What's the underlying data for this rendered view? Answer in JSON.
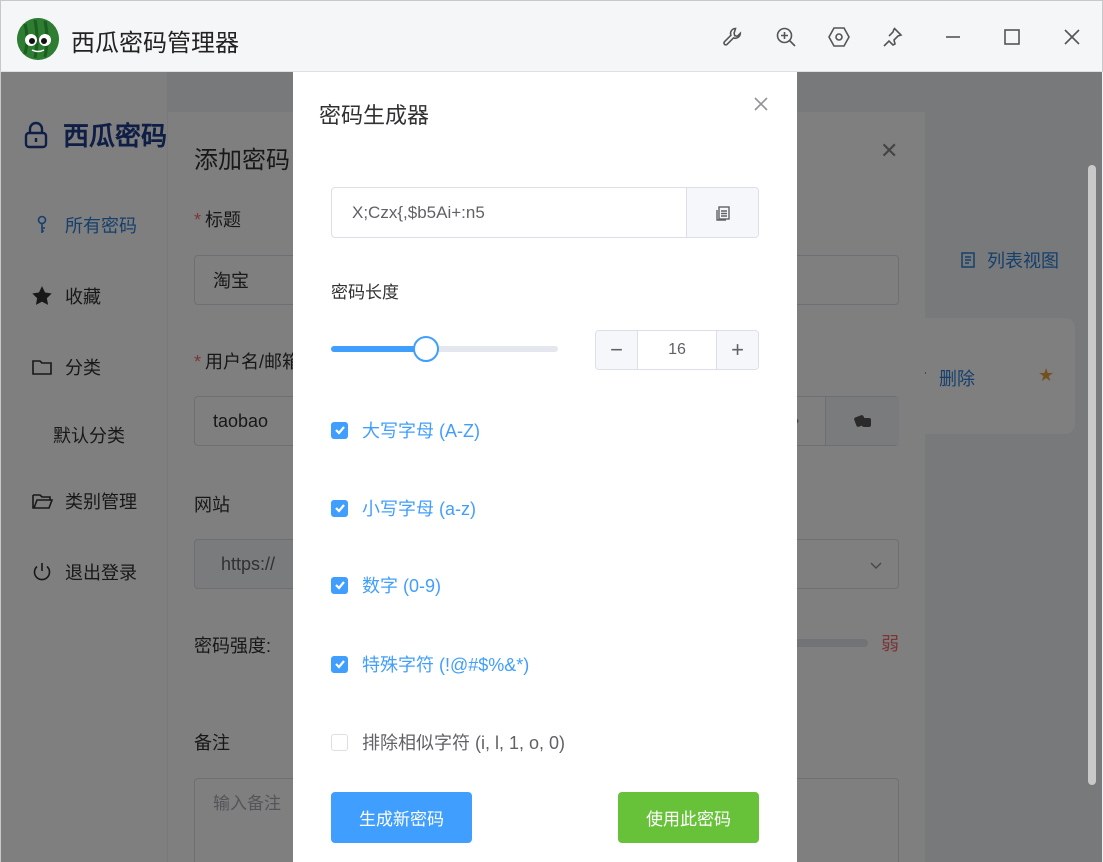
{
  "window": {
    "title": "西瓜密码管理器",
    "toolbar_icons": [
      "wrench-icon",
      "zoom-in-icon",
      "settings-hex-icon",
      "pin-icon",
      "minimize-icon",
      "maximize-icon",
      "close-icon"
    ]
  },
  "sidebar": {
    "brand": "西瓜密码",
    "items": [
      {
        "label": "所有密码",
        "icon": "key-icon",
        "active": true
      },
      {
        "label": "收藏",
        "icon": "star-icon"
      },
      {
        "label": "分类",
        "icon": "folder-icon"
      },
      {
        "label": "默认分类",
        "sub": true
      },
      {
        "label": "类别管理",
        "icon": "folder-open-icon"
      },
      {
        "label": "退出登录",
        "icon": "power-icon"
      }
    ]
  },
  "main": {
    "list_view_label": "列表视图",
    "card": {
      "delete_label": "删除"
    }
  },
  "add_dialog": {
    "title": "添加密码",
    "title_label": "标题",
    "title_value": "淘宝",
    "username_label": "用户名/邮箱",
    "username_value": "taobao",
    "website_label": "网站",
    "website_prefix": "https://",
    "strength_label": "密码强度:",
    "strength_value": "弱",
    "notes_label": "备注",
    "notes_placeholder": "输入备注"
  },
  "generator": {
    "title": "密码生成器",
    "password": "X;Czx{,$b5Ai+:n5",
    "length_label": "密码长度",
    "length_value": "16",
    "slider_fraction": 0.42,
    "options": [
      {
        "label": "大写字母 (A-Z)",
        "checked": true
      },
      {
        "label": "小写字母 (a-z)",
        "checked": true
      },
      {
        "label": "数字 (0-9)",
        "checked": true
      },
      {
        "label": "特殊字符 (!@#$%&*)",
        "checked": true
      },
      {
        "label": "排除相似字符 (i, l, 1, o, 0)",
        "checked": false
      }
    ],
    "generate_button": "生成新密码",
    "use_button": "使用此密码"
  },
  "colors": {
    "primary": "#409eff",
    "success": "#67c23a",
    "danger": "#f56c6c",
    "brand": "#1f3d8a"
  }
}
